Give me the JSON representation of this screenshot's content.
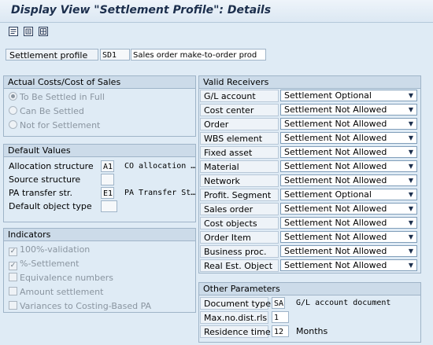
{
  "title": "Display View \"Settlement Profile\": Details",
  "toolbar": {
    "buttons": [
      "toolbar-icon-1",
      "toolbar-icon-2",
      "toolbar-icon-3"
    ]
  },
  "profile": {
    "label": "Settlement profile",
    "code": "SD1",
    "description": "Sales order make-to-order prod"
  },
  "actual_costs": {
    "title": "Actual Costs/Cost of Sales",
    "options": [
      {
        "label": "To Be Settled in Full",
        "selected": true
      },
      {
        "label": "Can Be Settled",
        "selected": false
      },
      {
        "label": "Not for Settlement",
        "selected": false
      }
    ]
  },
  "default_values": {
    "title": "Default Values",
    "allocation_structure": {
      "label": "Allocation structure",
      "code": "A1",
      "text": "CO allocation …"
    },
    "source_structure": {
      "label": "Source structure",
      "code": ""
    },
    "pa_transfer": {
      "label": "PA transfer str.",
      "code": "E1",
      "text": "PA Transfer St…"
    },
    "default_object_type": {
      "label": "Default object type",
      "code": ""
    }
  },
  "indicators": {
    "title": "Indicators",
    "items": [
      {
        "label": "100%-validation",
        "checked": true
      },
      {
        "label": "%-Settlement",
        "checked": true
      },
      {
        "label": "Equivalence numbers",
        "checked": false
      },
      {
        "label": "Amount settlement",
        "checked": false
      },
      {
        "label": "Variances to Costing-Based PA",
        "checked": false
      }
    ]
  },
  "valid_receivers": {
    "title": "Valid Receivers",
    "rows": [
      {
        "label": "G/L account",
        "value": "Settlement Optional"
      },
      {
        "label": "Cost center",
        "value": "Settlement Not Allowed"
      },
      {
        "label": "Order",
        "value": "Settlement Not Allowed"
      },
      {
        "label": "WBS element",
        "value": "Settlement Not Allowed"
      },
      {
        "label": "Fixed asset",
        "value": "Settlement Not Allowed"
      },
      {
        "label": "Material",
        "value": "Settlement Not Allowed"
      },
      {
        "label": "Network",
        "value": "Settlement Not Allowed"
      },
      {
        "label": "Profit. Segment",
        "value": "Settlement Optional"
      },
      {
        "label": "Sales order",
        "value": "Settlement Not Allowed"
      },
      {
        "label": "Cost objects",
        "value": "Settlement Not Allowed"
      },
      {
        "label": "Order Item",
        "value": "Settlement Not Allowed"
      },
      {
        "label": "Business proc.",
        "value": "Settlement Not Allowed"
      },
      {
        "label": "Real Est. Object",
        "value": "Settlement Not Allowed"
      }
    ]
  },
  "other_parameters": {
    "title": "Other Parameters",
    "document_type": {
      "label": "Document type",
      "code": "SA",
      "text": "G/L account document"
    },
    "max_dist_rls": {
      "label": "Max.no.dist.rls",
      "value": "1"
    },
    "residence_time": {
      "label": "Residence time",
      "value": "12",
      "unit": "Months"
    }
  }
}
